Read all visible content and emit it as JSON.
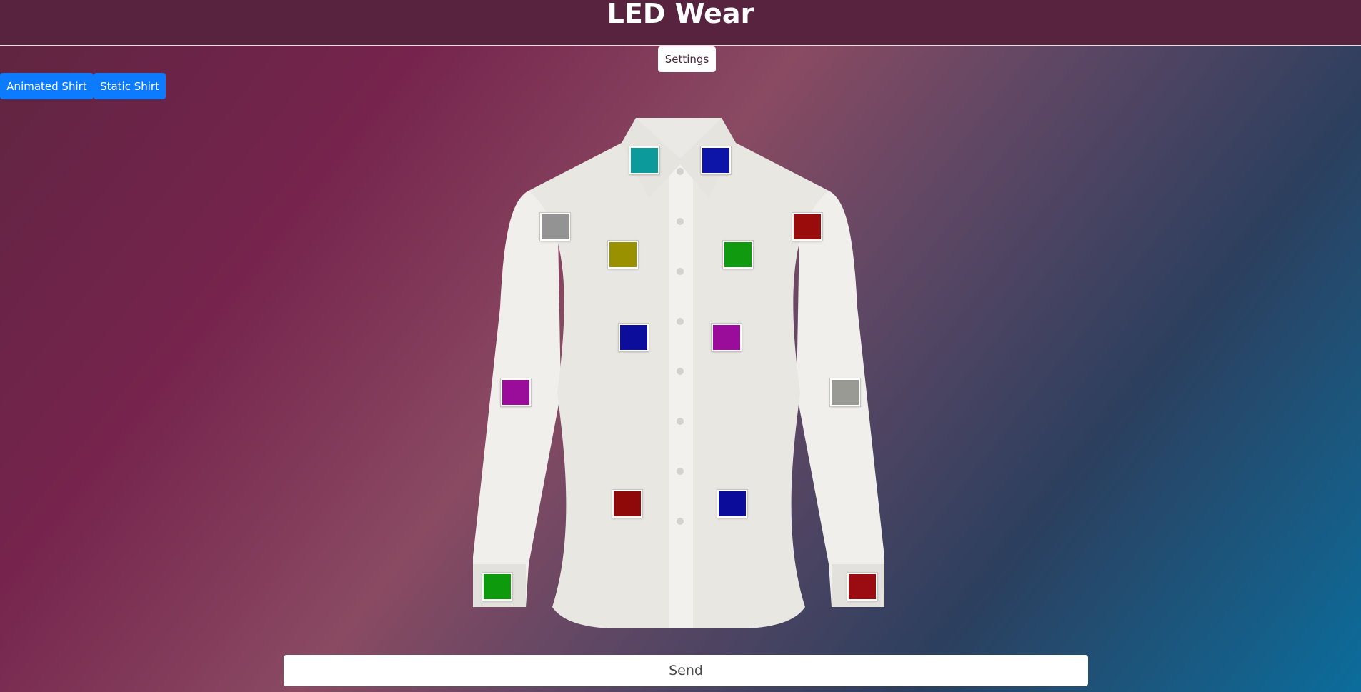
{
  "header": {
    "title": "LED Wear"
  },
  "toolbar": {
    "settings_label": "Settings",
    "animated_label": "Animated Shirt",
    "static_label": "Static Shirt"
  },
  "leds": [
    {
      "id": "collar-left",
      "color": "#0d9a9a"
    },
    {
      "id": "collar-right",
      "color": "#0d14a8"
    },
    {
      "id": "shoulder-left",
      "color": "#939393"
    },
    {
      "id": "shoulder-right",
      "color": "#9a0b0b"
    },
    {
      "id": "chest-left-upper",
      "color": "#9a9100"
    },
    {
      "id": "chest-right-upper",
      "color": "#0f9a0f"
    },
    {
      "id": "chest-left-mid",
      "color": "#0c0d9a"
    },
    {
      "id": "chest-right-mid",
      "color": "#9a0d9a"
    },
    {
      "id": "sleeve-left",
      "color": "#9a0c9a"
    },
    {
      "id": "sleeve-right",
      "color": "#9a9a94"
    },
    {
      "id": "waist-left",
      "color": "#8f0909"
    },
    {
      "id": "waist-right",
      "color": "#0b0d9a"
    },
    {
      "id": "cuff-left",
      "color": "#0d9a0d"
    },
    {
      "id": "cuff-right",
      "color": "#9a0c12"
    }
  ],
  "footer": {
    "send_label": "Send"
  }
}
